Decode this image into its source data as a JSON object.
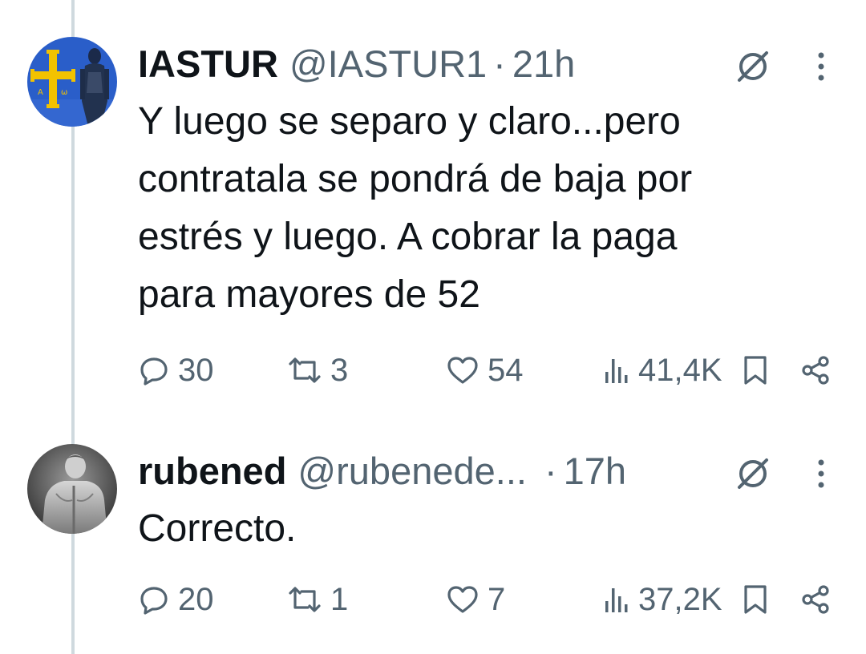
{
  "tweets": [
    {
      "display_name": "IASTUR",
      "handle": "@IASTUR1",
      "separator": "·",
      "time": "21h",
      "text": "Y luego se separo y claro...pero\ncontratala se pondrá de baja por\nestrés y luego. A cobrar la paga\npara mayores de 52",
      "replies": "30",
      "reposts": "3",
      "likes": "54",
      "views": "41,4K",
      "avatar_icon": "asturias-flag-avatar"
    },
    {
      "display_name": "rubened",
      "handle": "@rubenede...",
      "separator": "·",
      "time": "17h",
      "text": "Correcto.",
      "replies": "20",
      "reposts": "1",
      "likes": "7",
      "views": "37,2K",
      "avatar_icon": "person-back-avatar"
    }
  ],
  "icons": {
    "grok": "grok-icon",
    "more": "more-icon",
    "reply": "reply-icon",
    "repost": "repost-icon",
    "like": "like-icon",
    "views": "views-icon",
    "bookmark": "bookmark-icon",
    "share": "share-icon"
  },
  "colors": {
    "text_primary": "#0f1419",
    "text_secondary": "#536471",
    "thread_line": "#cfd9de",
    "flag_blue": "#2a5ec9",
    "flag_gold": "#f2c200"
  }
}
